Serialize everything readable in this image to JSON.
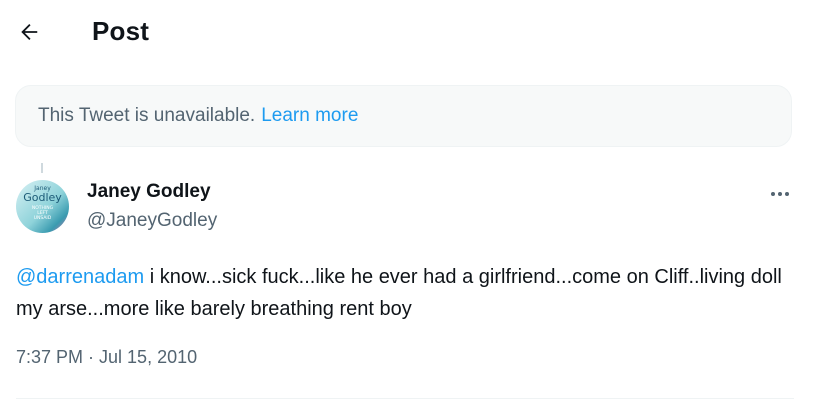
{
  "header": {
    "title": "Post"
  },
  "notice": {
    "text": "This Tweet is unavailable.",
    "link": "Learn more"
  },
  "author": {
    "name": "Janey Godley",
    "handle": "@JaneyGodley",
    "avatar_text": {
      "line1": "Janey",
      "line2": "Godley",
      "line3": "NOTHING",
      "line4": "LEFT",
      "line5": "UNSAID"
    }
  },
  "tweet": {
    "mention": "@darrenadam",
    "text": " i know...sick fuck...like he ever had a girlfriend...come on Cliff..living doll my arse...more like barely breathing rent boy",
    "timestamp": "7:37 PM · Jul 15, 2010"
  },
  "colors": {
    "accent": "#1d9bf0",
    "muted": "#536471",
    "notice_bg": "#f7f9f9"
  },
  "icons": {
    "back": "arrow-left-icon",
    "more": "more-horizontal-icon"
  }
}
